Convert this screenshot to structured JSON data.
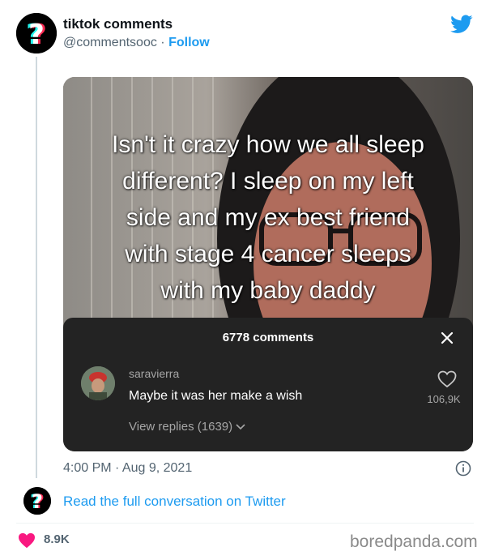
{
  "header": {
    "display_name": "tiktok comments",
    "handle": "@commentsooc",
    "separator": "·",
    "follow_label": "Follow"
  },
  "media": {
    "caption_lines": [
      "Isn't it crazy how we all sleep",
      "different? I sleep on my left",
      "side and my ex best friend",
      "with stage 4 cancer sleeps",
      "with my baby daddy"
    ],
    "comments_panel": {
      "count_label": "6778 comments",
      "comment": {
        "username": "saravierra",
        "text": "Maybe it was her make a wish",
        "likes": "106,9K",
        "view_replies": "View replies (1639)"
      }
    }
  },
  "meta": {
    "timestamp": "4:00 PM · Aug 9, 2021"
  },
  "footer": {
    "read_link": "Read the full conversation on Twitter",
    "likes": "8.9K",
    "watermark": "boredpanda.com"
  },
  "colors": {
    "twitter_blue": "#1d9bf0",
    "like_pink": "#f91880",
    "panel_bg": "#232323"
  },
  "icons": [
    "twitter-logo-icon",
    "close-icon",
    "heart-outline-icon",
    "chevron-down-icon",
    "info-icon",
    "heart-filled-icon"
  ]
}
